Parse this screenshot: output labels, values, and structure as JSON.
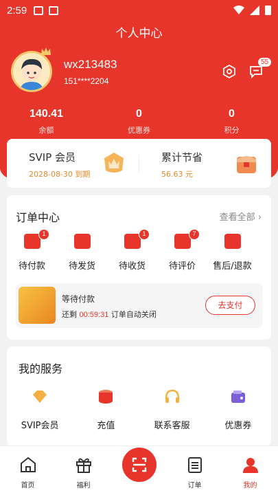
{
  "status_bar": {
    "time": "2:59"
  },
  "header": {
    "title": "个人中心"
  },
  "profile": {
    "username": "wx213483",
    "phone": "151****2204",
    "message_count": "55"
  },
  "stats": [
    {
      "value": "140.41",
      "label": "余额"
    },
    {
      "value": "0",
      "label": "优惠券"
    },
    {
      "value": "0",
      "label": "积分"
    }
  ],
  "vip": {
    "title": "SVIP 会员",
    "expiry": "2028-08-30 到期",
    "savings_title": "累计节省",
    "savings_value": "56.63 元"
  },
  "orders": {
    "title": "订单中心",
    "see_all": "查看全部",
    "items": [
      {
        "label": "待付款",
        "badge": "1"
      },
      {
        "label": "待发货",
        "badge": ""
      },
      {
        "label": "待收货",
        "badge": "1"
      },
      {
        "label": "待评价",
        "badge": "7"
      },
      {
        "label": "售后/退款",
        "badge": ""
      }
    ],
    "pending": {
      "title": "等待付款",
      "remaining_prefix": "还剩",
      "countdown": "00:59:31",
      "remaining_suffix": "订单自动关闭",
      "button": "去支付"
    }
  },
  "services": {
    "title": "我的服务",
    "items": [
      {
        "label": "SVIP会员",
        "icon": "vip-diamond-icon"
      },
      {
        "label": "充值",
        "icon": "coins-icon"
      },
      {
        "label": "联系客服",
        "icon": "headset-icon"
      },
      {
        "label": "优惠券",
        "icon": "wallet-icon"
      }
    ]
  },
  "tabbar": [
    {
      "label": "首页",
      "icon": "home-icon"
    },
    {
      "label": "福利",
      "icon": "gift-icon"
    },
    {
      "label": "",
      "icon": "scan-icon"
    },
    {
      "label": "订单",
      "icon": "clipboard-icon"
    },
    {
      "label": "我的",
      "icon": "user-icon",
      "active": true
    }
  ],
  "colors": {
    "accent": "#e8352b",
    "gold": "#e3892a"
  }
}
